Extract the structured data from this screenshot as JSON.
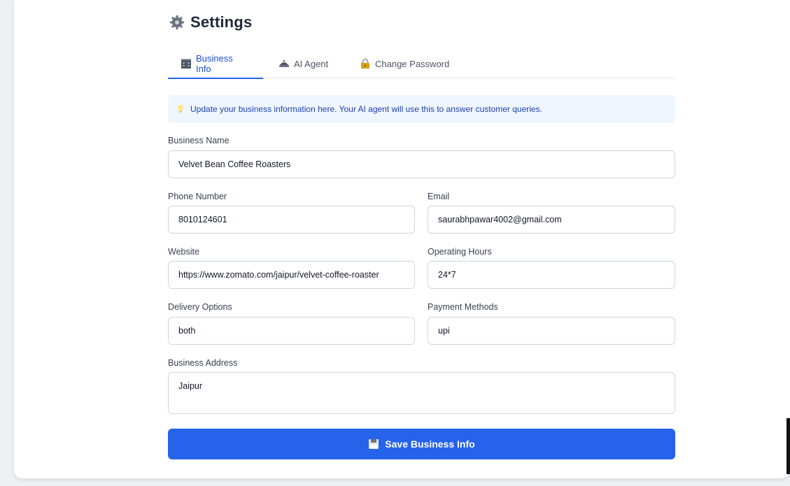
{
  "header": {
    "title": "Settings",
    "icon": "gear-icon"
  },
  "tabs": [
    {
      "label": "Business Info",
      "icon": "building-icon",
      "active": true
    },
    {
      "label": "AI Agent",
      "icon": "robot-icon",
      "active": false
    },
    {
      "label": "Change Password",
      "icon": "lock-icon",
      "active": false
    }
  ],
  "banner": {
    "icon": "lightbulb-icon",
    "text": "Update your business information here. Your AI agent will use this to answer customer queries."
  },
  "form": {
    "business_name": {
      "label": "Business Name",
      "value": "Velvet Bean Coffee Roasters"
    },
    "phone": {
      "label": "Phone Number",
      "value": "8010124601"
    },
    "email": {
      "label": "Email",
      "value": "saurabhpawar4002@gmail.com"
    },
    "website": {
      "label": "Website",
      "value": "https://www.zomato.com/jaipur/velvet-coffee-roaster"
    },
    "hours": {
      "label": "Operating Hours",
      "value": "24*7"
    },
    "delivery": {
      "label": "Delivery Options",
      "value": "both"
    },
    "payment": {
      "label": "Payment Methods",
      "value": "upi"
    },
    "address": {
      "label": "Business Address",
      "value": "Jaipur"
    }
  },
  "save_button": {
    "label": "Save Business Info",
    "icon": "floppy-disk-icon"
  },
  "colors": {
    "accent": "#2563eb",
    "banner_bg": "#eff6ff",
    "banner_text": "#1e40af"
  }
}
